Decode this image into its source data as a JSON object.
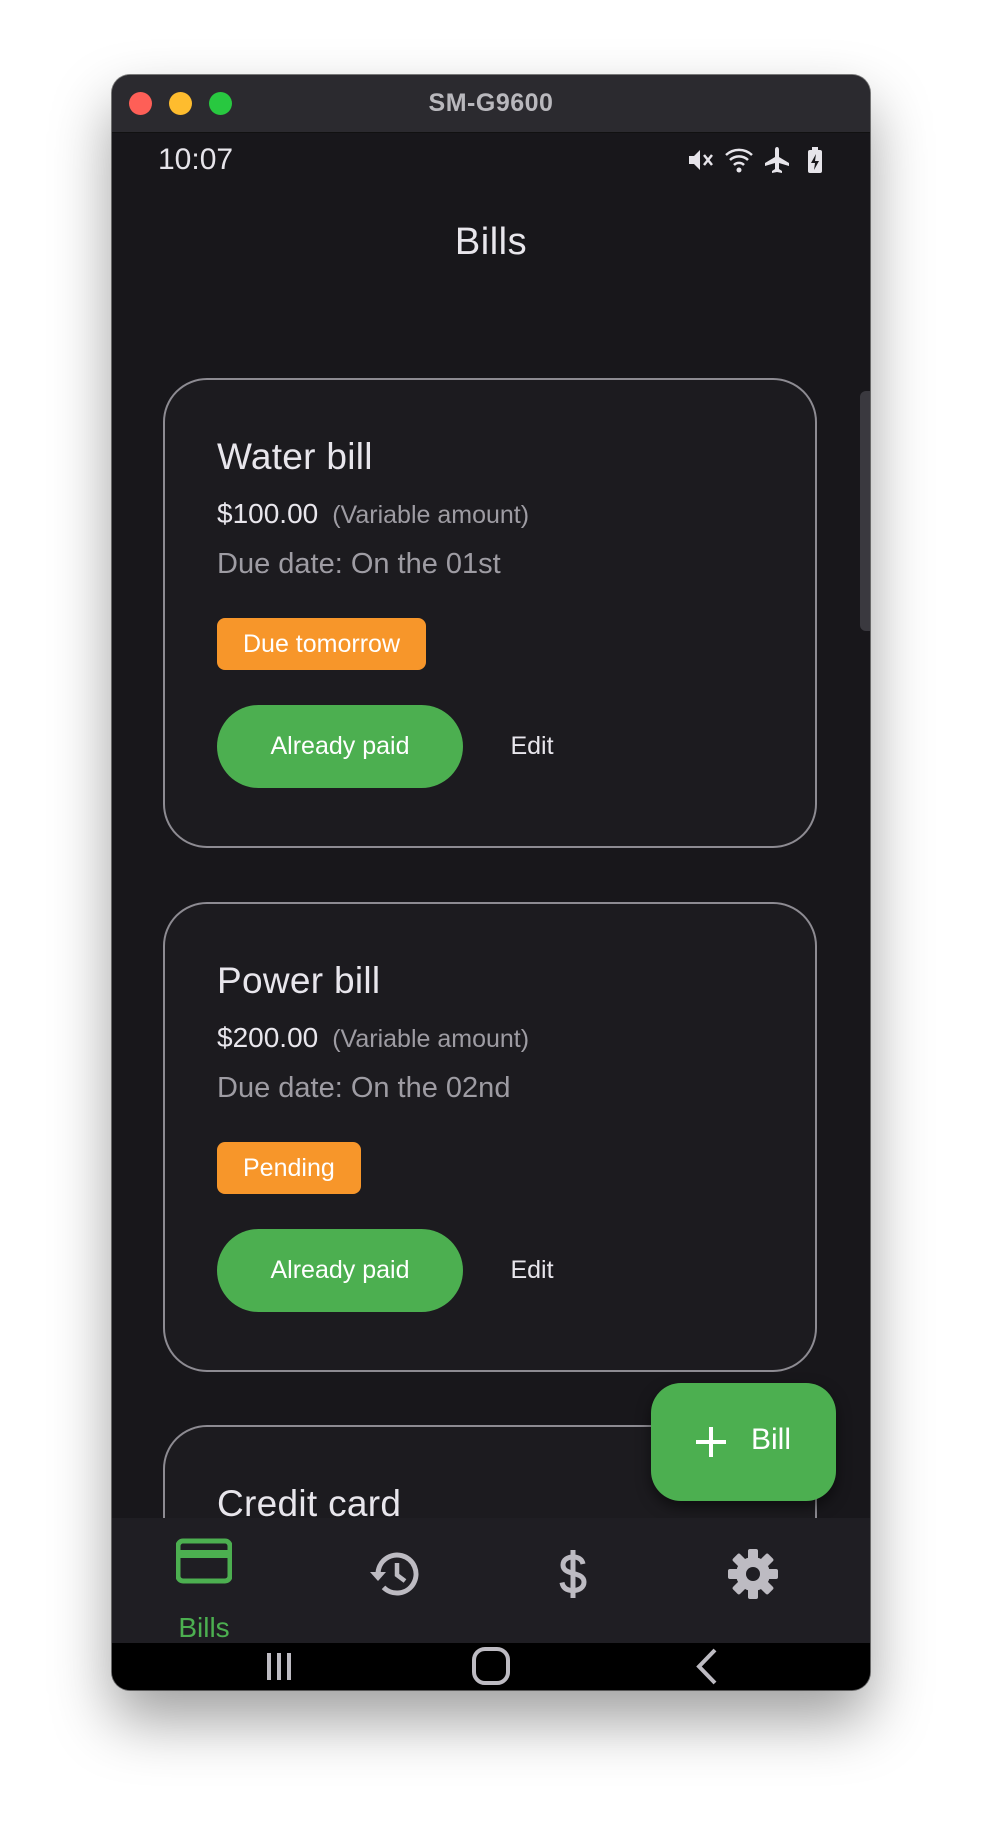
{
  "window": {
    "title": "SM-G9600"
  },
  "status_bar": {
    "time": "10:07",
    "icons": [
      "mute-icon",
      "wifi-icon",
      "airplane-icon",
      "battery-charging-icon"
    ]
  },
  "app_bar": {
    "title": "Bills"
  },
  "bills": [
    {
      "name": "Water bill",
      "amount": "$100.00",
      "variable": "(Variable amount)",
      "due": "Due date: On the 01st",
      "status": "Due tomorrow",
      "status_color": "#f7962a",
      "paid_label": "Already paid",
      "edit_label": "Edit"
    },
    {
      "name": "Power bill",
      "amount": "$200.00",
      "variable": "(Variable amount)",
      "due": "Due date: On the 02nd",
      "status": "Pending",
      "status_color": "#f7962a",
      "paid_label": "Already paid",
      "edit_label": "Edit"
    },
    {
      "name": "Credit card"
    }
  ],
  "fab": {
    "label": "Bill",
    "icon": "plus-icon"
  },
  "bottom_nav": {
    "items": [
      {
        "label": "Bills",
        "icon": "credit-card-icon",
        "active": true
      },
      {
        "label": "",
        "icon": "history-icon",
        "active": false
      },
      {
        "label": "",
        "icon": "dollar-icon",
        "active": false
      },
      {
        "label": "",
        "icon": "gear-icon",
        "active": false
      }
    ]
  },
  "system_nav": {
    "icons": [
      "recent-apps-icon",
      "home-icon",
      "back-icon"
    ]
  },
  "colors": {
    "accent": "#4caf50",
    "badge": "#f7962a",
    "background": "#18171b"
  }
}
